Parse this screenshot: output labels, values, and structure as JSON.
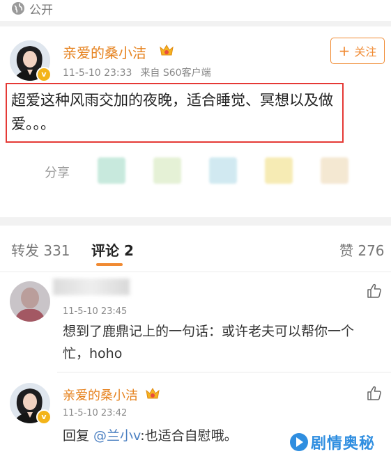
{
  "header": {
    "visibility_label": "公开"
  },
  "post": {
    "author_name": "亲爱的桑小洁",
    "timestamp": "11-5-10 23:33",
    "source": "来自 S60客户端",
    "follow_label": "关注",
    "text": "超爱这种风雨交加的夜晚，适合睡觉、冥想以及做爱。。。",
    "share_label": "分享"
  },
  "tabs": {
    "repost_label": "转发 331",
    "comments_label": "评论 2",
    "likes_label": "赞 276"
  },
  "comments": [
    {
      "timestamp": "11-5-10 23:45",
      "text": "想到了鹿鼎记上的一句话：或许老夫可以帮你一个忙，hoho"
    },
    {
      "author_name": "亲爱的桑小洁",
      "timestamp": "11-5-10 23:42",
      "reply_prefix": "回复 ",
      "mention": "@兰小v",
      "reply_text": ":也适合自慰哦。"
    }
  ],
  "watermark": {
    "text": "剧情奥秘"
  },
  "colors": {
    "name_orange": "#e6821e",
    "follow_orange": "#f08a32",
    "highlight_red": "#e53935",
    "mention_blue": "#4a7fc1",
    "watermark_blue": "#2f8ee0"
  }
}
